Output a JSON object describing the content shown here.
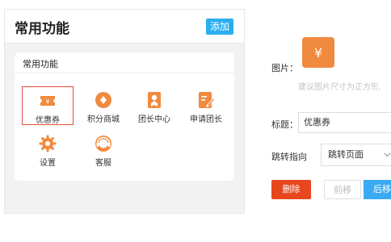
{
  "panel": {
    "title": "常用功能",
    "add_label": "添加",
    "card_title": "常用功能",
    "items": [
      {
        "label": "优惠券",
        "icon": "coupon-icon"
      },
      {
        "label": "积分商城",
        "icon": "points-mall-icon"
      },
      {
        "label": "团长中心",
        "icon": "leader-center-icon"
      },
      {
        "label": "申请团长",
        "icon": "apply-leader-icon"
      },
      {
        "label": "设置",
        "icon": "settings-gear-icon"
      },
      {
        "label": "客服",
        "icon": "customer-service-icon"
      }
    ]
  },
  "editor": {
    "picture_label": "图片：",
    "picture_hint": "建议图片尺寸为正方形,",
    "title_label": "标题：",
    "title_value": "优惠券",
    "jump_label": "跳转指向",
    "jump_value": "跳转页面",
    "delete_label": "删除",
    "prev_label": "前移",
    "next_label": "后移"
  },
  "colors": {
    "accent_orange": "#f08a3e",
    "selected_border": "#e54b3c",
    "add_button": "#2baef0",
    "delete_button": "#e8461e",
    "next_button": "#3aaaf2"
  }
}
